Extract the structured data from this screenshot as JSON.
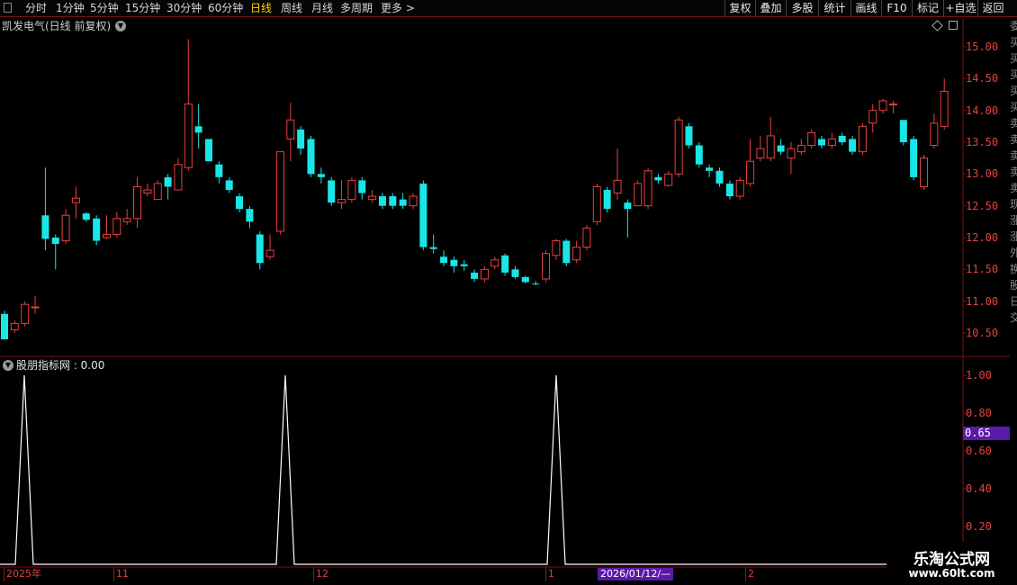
{
  "toolbar": {
    "periods": [
      {
        "label": "分时",
        "active": false
      },
      {
        "label": "1分钟",
        "active": false
      },
      {
        "label": "5分钟",
        "active": false
      },
      {
        "label": "15分钟",
        "active": false
      },
      {
        "label": "30分钟",
        "active": false
      },
      {
        "label": "60分钟",
        "active": false
      },
      {
        "label": "日线",
        "active": true
      },
      {
        "label": "周线",
        "active": false
      },
      {
        "label": "月线",
        "active": false
      },
      {
        "label": "多周期",
        "active": false
      },
      {
        "label": "更多 >",
        "active": false
      }
    ],
    "buttons": [
      "复权",
      "叠加",
      "多股",
      "统计",
      "画线",
      "F10",
      "标记",
      "+自选",
      "返回"
    ]
  },
  "chart_title": "凯发电气(日线 前复权)",
  "price_axis": [
    "15.00",
    "14.50",
    "14.00",
    "13.50",
    "13.00",
    "12.50",
    "12.00",
    "11.50",
    "11.00",
    "10.50"
  ],
  "indicator": {
    "title": "股朋指标网 : 0.00",
    "axis": [
      "1.00",
      "0.80",
      "0.60",
      "0.40",
      "0.20"
    ],
    "current_value": "0.65"
  },
  "time_axis": {
    "labels": [
      "2025年",
      "11",
      "12",
      "1",
      "2"
    ],
    "cursor_date": "2026/01/12/—"
  },
  "right_strip": [
    "委",
    "买",
    "买",
    "买",
    "买",
    "买",
    "卖",
    "卖",
    "卖",
    "卖",
    "卖",
    "现",
    "涨",
    "涨",
    "外",
    "换",
    "股",
    "日",
    "交"
  ],
  "watermark": {
    "line1": "乐淘公式网",
    "line2": "www.60lt.com"
  },
  "colors": {
    "up": "#e84040",
    "down": "#19e6e6",
    "axis": "#7a1010",
    "active_tab": "#ffd200",
    "highlight": "#5a1aa8"
  },
  "chart_data": {
    "type": "candlestick",
    "title": "凯发电气(日线 前复权)",
    "ylim": [
      10.3,
      15.2
    ],
    "candles": [
      [
        10.8,
        10.4,
        10.85,
        10.4
      ],
      [
        10.55,
        10.65,
        10.7,
        10.5
      ],
      [
        10.65,
        10.95,
        11.0,
        10.6
      ],
      [
        10.9,
        10.91,
        11.08,
        10.8
      ],
      [
        12.35,
        11.98,
        13.1,
        11.8
      ],
      [
        12.0,
        11.9,
        12.05,
        11.5
      ],
      [
        11.95,
        12.35,
        12.45,
        11.9
      ],
      [
        12.55,
        12.62,
        12.8,
        12.3
      ],
      [
        12.38,
        12.28,
        12.4,
        12.25
      ],
      [
        12.3,
        11.95,
        12.35,
        11.88
      ],
      [
        12.0,
        12.05,
        12.35,
        11.98
      ],
      [
        12.05,
        12.3,
        12.4,
        12.0
      ],
      [
        12.25,
        12.3,
        12.45,
        12.2
      ],
      [
        12.3,
        12.8,
        12.95,
        12.15
      ],
      [
        12.7,
        12.75,
        12.85,
        12.65
      ],
      [
        12.6,
        12.85,
        12.9,
        12.6
      ],
      [
        12.95,
        12.8,
        13.0,
        12.6
      ],
      [
        12.75,
        13.15,
        13.25,
        12.75
      ],
      [
        13.1,
        14.1,
        15.12,
        13.05
      ],
      [
        13.75,
        13.65,
        14.1,
        13.4
      ],
      [
        13.55,
        13.2,
        13.55,
        13.2
      ],
      [
        13.15,
        12.95,
        13.2,
        12.85
      ],
      [
        12.9,
        12.75,
        12.95,
        12.7
      ],
      [
        12.65,
        12.45,
        12.7,
        12.4
      ],
      [
        12.45,
        12.25,
        12.5,
        12.15
      ],
      [
        12.05,
        11.6,
        12.1,
        11.5
      ],
      [
        11.7,
        11.8,
        12.05,
        11.65
      ],
      [
        12.1,
        13.35,
        13.35,
        12.05
      ],
      [
        13.55,
        13.85,
        14.12,
        13.2
      ],
      [
        13.7,
        13.4,
        13.75,
        13.3
      ],
      [
        13.55,
        13.0,
        13.6,
        12.95
      ],
      [
        13.0,
        12.95,
        13.1,
        12.85
      ],
      [
        12.9,
        12.55,
        12.95,
        12.5
      ],
      [
        12.55,
        12.6,
        12.9,
        12.45
      ],
      [
        12.6,
        12.9,
        12.95,
        12.55
      ],
      [
        12.9,
        12.7,
        12.95,
        12.6
      ],
      [
        12.6,
        12.65,
        12.75,
        12.55
      ],
      [
        12.65,
        12.5,
        12.7,
        12.45
      ],
      [
        12.65,
        12.5,
        12.7,
        12.45
      ],
      [
        12.6,
        12.5,
        12.7,
        12.45
      ],
      [
        12.5,
        12.65,
        12.7,
        12.45
      ],
      [
        12.85,
        11.85,
        12.9,
        11.8
      ],
      [
        11.85,
        11.82,
        12.05,
        11.75
      ],
      [
        11.7,
        11.6,
        11.8,
        11.55
      ],
      [
        11.65,
        11.55,
        11.7,
        11.45
      ],
      [
        11.58,
        11.55,
        11.65,
        11.48
      ],
      [
        11.45,
        11.35,
        11.5,
        11.3
      ],
      [
        11.35,
        11.5,
        11.55,
        11.3
      ],
      [
        11.55,
        11.65,
        11.7,
        11.5
      ],
      [
        11.72,
        11.45,
        11.75,
        11.4
      ],
      [
        11.5,
        11.38,
        11.55,
        11.35
      ],
      [
        11.38,
        11.3,
        11.4,
        11.28
      ],
      [
        11.28,
        11.27,
        11.32,
        11.25
      ],
      [
        11.35,
        11.75,
        11.8,
        11.3
      ],
      [
        11.72,
        11.95,
        11.98,
        11.65
      ],
      [
        11.95,
        11.6,
        11.98,
        11.55
      ],
      [
        11.65,
        11.85,
        11.95,
        11.6
      ],
      [
        11.85,
        12.15,
        12.2,
        11.8
      ],
      [
        12.25,
        12.8,
        12.85,
        12.2
      ],
      [
        12.75,
        12.45,
        12.8,
        12.4
      ],
      [
        12.7,
        12.9,
        13.4,
        12.6
      ],
      [
        12.55,
        12.45,
        12.6,
        12.0
      ],
      [
        12.5,
        12.85,
        12.9,
        12.5
      ],
      [
        12.5,
        13.05,
        13.1,
        12.45
      ],
      [
        12.95,
        12.9,
        13.0,
        12.85
      ],
      [
        12.82,
        13.0,
        13.05,
        12.8
      ],
      [
        13.0,
        13.85,
        13.9,
        12.95
      ],
      [
        13.75,
        13.45,
        13.8,
        13.4
      ],
      [
        13.45,
        13.15,
        13.5,
        13.1
      ],
      [
        13.1,
        13.05,
        13.15,
        12.95
      ],
      [
        13.05,
        12.85,
        13.1,
        12.8
      ],
      [
        12.85,
        12.65,
        12.9,
        12.6
      ],
      [
        12.65,
        12.9,
        12.95,
        12.6
      ],
      [
        12.85,
        13.2,
        13.55,
        12.8
      ],
      [
        13.25,
        13.4,
        13.6,
        13.2
      ],
      [
        13.25,
        13.6,
        13.9,
        13.2
      ],
      [
        13.45,
        13.35,
        13.55,
        13.3
      ],
      [
        13.25,
        13.4,
        13.5,
        13.0
      ],
      [
        13.35,
        13.45,
        13.55,
        13.3
      ],
      [
        13.45,
        13.65,
        13.7,
        13.4
      ],
      [
        13.55,
        13.45,
        13.6,
        13.4
      ],
      [
        13.45,
        13.55,
        13.65,
        13.4
      ],
      [
        13.6,
        13.5,
        13.65,
        13.45
      ],
      [
        13.55,
        13.35,
        13.6,
        13.3
      ],
      [
        13.35,
        13.75,
        13.8,
        13.3
      ],
      [
        13.8,
        14.0,
        14.1,
        13.65
      ],
      [
        14.0,
        14.15,
        14.18,
        13.95
      ],
      [
        14.1,
        14.1,
        14.15,
        13.95
      ],
      [
        13.85,
        13.5,
        13.85,
        13.45
      ],
      [
        13.55,
        12.95,
        13.6,
        12.9
      ],
      [
        12.8,
        13.25,
        13.3,
        12.75
      ],
      [
        13.45,
        13.8,
        13.95,
        13.4
      ],
      [
        13.75,
        14.3,
        14.5,
        13.7
      ]
    ],
    "indicator_peak_dates": [
      "2025年 start",
      "11月",
      "1月"
    ],
    "indicator_ylim": [
      0,
      1
    ]
  }
}
